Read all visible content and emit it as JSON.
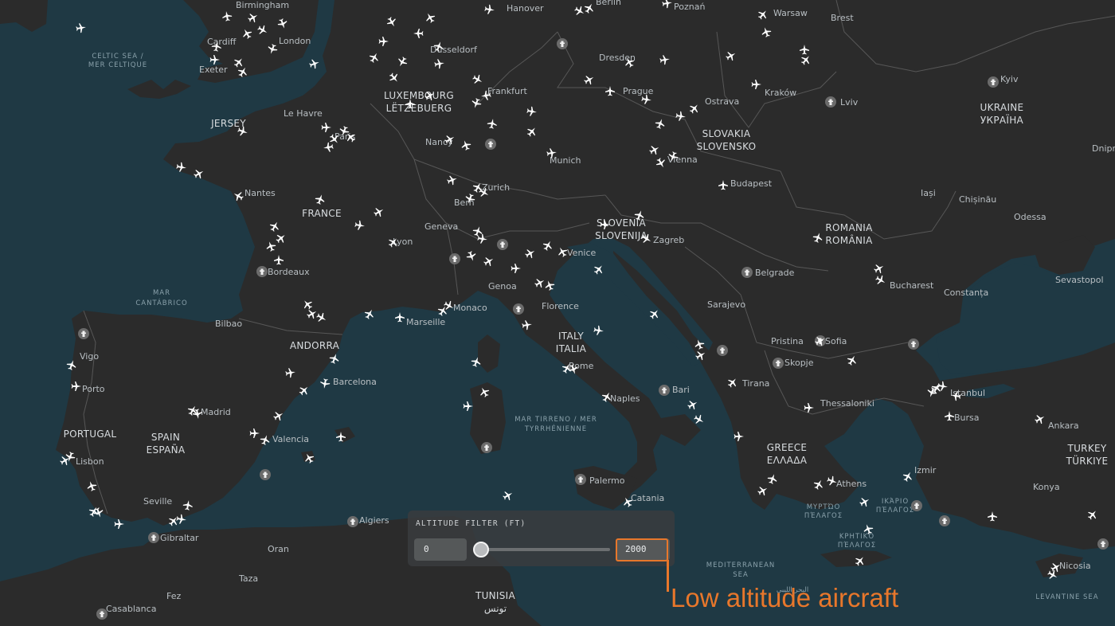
{
  "colors": {
    "sea": "#1f3944",
    "land": "#2b2b2b",
    "border": "#555555",
    "aircraft": "#ffffff",
    "accent": "#e8772b",
    "panel": "#3a3c3e"
  },
  "icons": {
    "aircraft": "airplane-icon",
    "airport": "airport-icon"
  },
  "map": {
    "countries": [
      {
        "name": "FRANCE"
      },
      {
        "name": "SPAIN"
      },
      {
        "name": "ESPAÑA"
      },
      {
        "name": "PORTUGAL"
      },
      {
        "name": "ITALY"
      },
      {
        "name": "ITALIA"
      },
      {
        "name": "GREECE"
      },
      {
        "name": "ΕΛΛΑΔΑ"
      },
      {
        "name": "TURKEY"
      },
      {
        "name": "TÜRKIYE"
      },
      {
        "name": "ROMANIA"
      },
      {
        "name": "ROMÂNIA"
      },
      {
        "name": "UKRAINE"
      },
      {
        "name": "УКРАЇНА"
      },
      {
        "name": "SLOVAKIA"
      },
      {
        "name": "SLOVENSKO"
      },
      {
        "name": "SLOVENIA"
      },
      {
        "name": "SLOVENIJA"
      },
      {
        "name": "LUXEMBOURG"
      },
      {
        "name": "LËTZEBUERG"
      },
      {
        "name": "ANDORRA"
      },
      {
        "name": "TUNISIA"
      },
      {
        "name": "تونس"
      },
      {
        "name": "JERSEY"
      }
    ],
    "seas": [
      {
        "name": "CELTIC SEA /"
      },
      {
        "name": "MER CELTIQUE"
      },
      {
        "name": "MAR"
      },
      {
        "name": "CANTÁBRICO"
      },
      {
        "name": "MAR TIRRENO / MER"
      },
      {
        "name": "TYRRHÉNIENNE"
      },
      {
        "name": "MEDITERRANEAN"
      },
      {
        "name": "SEA"
      },
      {
        "name": "ΜΥΡΤΏΟ"
      },
      {
        "name": "ΠΈΛΑΓΟΣ"
      },
      {
        "name": "ΙΚΆΡΙΟ"
      },
      {
        "name": "ΠΈΛΑΓΟΣ"
      },
      {
        "name": "ΚΡΗΤΙΚΌ"
      },
      {
        "name": "ΠΈΛΑΓΟΣ"
      },
      {
        "name": "LEVANTINE SEA"
      },
      {
        "name": "البحر الليبي"
      }
    ],
    "cities": [
      {
        "name": "Birmingham"
      },
      {
        "name": "London"
      },
      {
        "name": "Cardiff"
      },
      {
        "name": "Exeter"
      },
      {
        "name": "Le Havre"
      },
      {
        "name": "Paris"
      },
      {
        "name": "Nantes"
      },
      {
        "name": "Bordeaux"
      },
      {
        "name": "Bilbao"
      },
      {
        "name": "Vigo"
      },
      {
        "name": "Porto"
      },
      {
        "name": "Lisbon"
      },
      {
        "name": "Seville"
      },
      {
        "name": "Gibraltar"
      },
      {
        "name": "Madrid"
      },
      {
        "name": "Valencia"
      },
      {
        "name": "Barcelona"
      },
      {
        "name": "Marseille"
      },
      {
        "name": "Monaco"
      },
      {
        "name": "Lyon"
      },
      {
        "name": "Geneva"
      },
      {
        "name": "Bern"
      },
      {
        "name": "Zurich"
      },
      {
        "name": "Nancy"
      },
      {
        "name": "Düsseldorf"
      },
      {
        "name": "Frankfurt"
      },
      {
        "name": "Munich"
      },
      {
        "name": "Hanover"
      },
      {
        "name": "Berlin"
      },
      {
        "name": "Dresden"
      },
      {
        "name": "Prague"
      },
      {
        "name": "Vienna"
      },
      {
        "name": "Budapest"
      },
      {
        "name": "Zagreb"
      },
      {
        "name": "Venice"
      },
      {
        "name": "Genoa"
      },
      {
        "name": "Florence"
      },
      {
        "name": "Rome"
      },
      {
        "name": "Naples"
      },
      {
        "name": "Bari"
      },
      {
        "name": "Palermo"
      },
      {
        "name": "Catania"
      },
      {
        "name": "Poznań"
      },
      {
        "name": "Warsaw"
      },
      {
        "name": "Brest"
      },
      {
        "name": "Kraków"
      },
      {
        "name": "Ostrava"
      },
      {
        "name": "Lviv"
      },
      {
        "name": "Kyiv"
      },
      {
        "name": "Dnipro"
      },
      {
        "name": "Odessa"
      },
      {
        "name": "Chișinău"
      },
      {
        "name": "Iași"
      },
      {
        "name": "Bucharest"
      },
      {
        "name": "Constanța"
      },
      {
        "name": "Sevastopol"
      },
      {
        "name": "Belgrade"
      },
      {
        "name": "Sarajevo"
      },
      {
        "name": "Sofia"
      },
      {
        "name": "Pristina"
      },
      {
        "name": "Skopje"
      },
      {
        "name": "Tirana"
      },
      {
        "name": "Thessaloniki"
      },
      {
        "name": "Athens"
      },
      {
        "name": "Istanbul"
      },
      {
        "name": "Bursa"
      },
      {
        "name": "Ankara"
      },
      {
        "name": "Izmir"
      },
      {
        "name": "Konya"
      },
      {
        "name": "Nicosia"
      },
      {
        "name": "Algiers"
      },
      {
        "name": "Oran"
      },
      {
        "name": "Taza"
      },
      {
        "name": "Fez"
      },
      {
        "name": "Casablanca"
      }
    ]
  },
  "filter": {
    "title": "ALTITUDE FILTER (FT)",
    "min_value": "0",
    "max_value": "2000"
  },
  "callout": {
    "text": "Low altitude aircraft"
  }
}
